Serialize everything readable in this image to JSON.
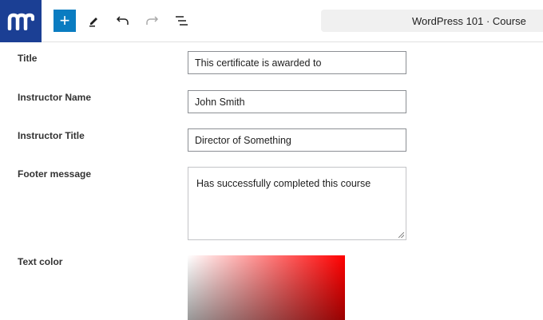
{
  "toolbar": {
    "doc_title": "WordPress 101 · Course"
  },
  "form": {
    "title_label": "Title",
    "title_value": "This certificate is awarded to",
    "instructor_name_label": "Instructor Name",
    "instructor_name_value": "John Smith",
    "instructor_title_label": "Instructor Title",
    "instructor_title_value": "Director of Something",
    "footer_label": "Footer message",
    "footer_value": "Has successfully completed this course",
    "text_color_label": "Text color"
  },
  "colors": {
    "brand": "#1b3f94",
    "accent": "#0a7cc1",
    "hue": "#ff0000"
  }
}
